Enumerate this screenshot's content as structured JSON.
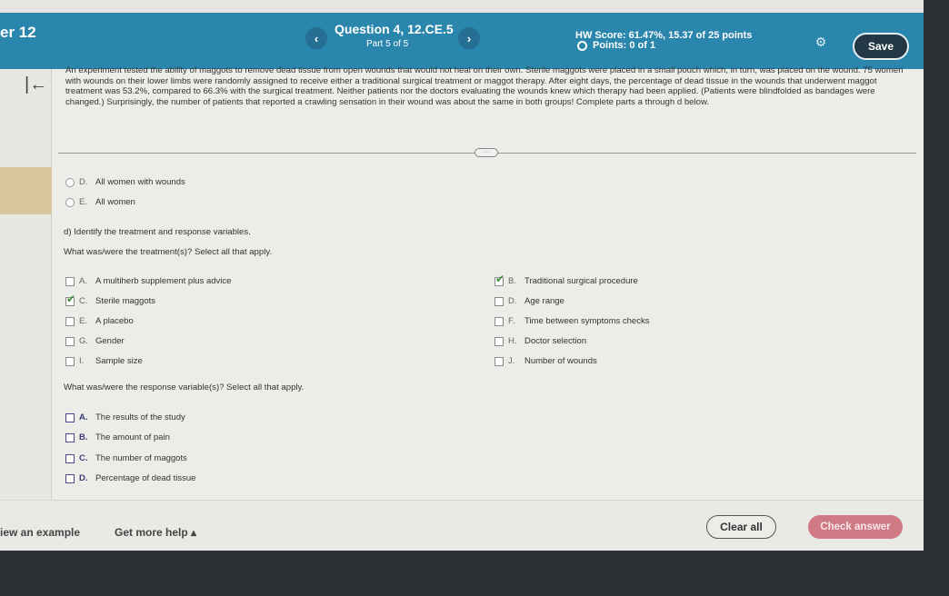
{
  "header": {
    "chapter": "er 12",
    "question_title": "Question 4, 12.CE.5",
    "question_part": "Part 5 of 5",
    "prev_icon": "chevron-left-icon",
    "prev_glyph": "‹",
    "next_icon": "chevron-right-icon",
    "next_glyph": "›",
    "hw_score": "HW Score: 61.47%, 15.37 of 25 points",
    "points": "Points: 0 of 1",
    "gear_glyph": "⚙",
    "save_label": "Save"
  },
  "sidebar": {
    "collapse_glyph": "|←"
  },
  "intro_text": "An experiment tested the ability of maggots to remove dead tissue from open wounds that would not heal on their own. Sterile maggots were placed in a small pouch which, in turn, was placed on the wound. 75 women with wounds on their lower limbs were randomly assigned to receive either a traditional surgical treatment or maggot therapy. After eight days, the percentage of dead tissue in the wounds that underwent maggot treatment was 53.2%, compared to 66.3% with the surgical treatment. Neither patients nor the doctors evaluating the wounds knew which therapy had been applied. (Patients were blindfolded as bandages were changed.) Surprisingly, the number of patients that reported a crawling sensation in their wound was about the same in both groups! Complete parts a through d below.",
  "divider_handle": "···",
  "prev_part_options": [
    {
      "letter": "D.",
      "label": "All women with wounds"
    },
    {
      "letter": "E.",
      "label": "All women"
    }
  ],
  "part_d": {
    "prompt": "d) Identify the treatment and response variables.",
    "treatment_question": "What was/were the treatment(s)? Select all that apply.",
    "treatment_options_left": [
      {
        "letter": "A.",
        "label": "A multiherb supplement plus advice",
        "checked": false
      },
      {
        "letter": "C.",
        "label": "Sterile maggots",
        "checked": true
      },
      {
        "letter": "E.",
        "label": "A placebo",
        "checked": false
      },
      {
        "letter": "G.",
        "label": "Gender",
        "checked": false
      },
      {
        "letter": "I.",
        "label": "Sample size",
        "checked": false
      }
    ],
    "treatment_options_right": [
      {
        "letter": "B.",
        "label": "Traditional surgical procedure",
        "checked": true
      },
      {
        "letter": "D.",
        "label": "Age range",
        "checked": false
      },
      {
        "letter": "F.",
        "label": "Time between symptoms checks",
        "checked": false
      },
      {
        "letter": "H.",
        "label": "Doctor selection",
        "checked": false
      },
      {
        "letter": "J.",
        "label": "Number of wounds",
        "checked": false
      }
    ],
    "response_question": "What was/were the response variable(s)? Select all that apply.",
    "response_options": [
      {
        "letter": "A.",
        "label": "The results of the study",
        "checked": false
      },
      {
        "letter": "B.",
        "label": "The amount of pain",
        "checked": false
      },
      {
        "letter": "C.",
        "label": "The number of maggots",
        "checked": false
      },
      {
        "letter": "D.",
        "label": "Percentage of dead tissue",
        "checked": false
      }
    ]
  },
  "footer": {
    "view_example": "iew an example",
    "get_help": "Get more help ▴",
    "clear_all": "Clear all",
    "check_answer": "Check answer"
  },
  "colors": {
    "header_bg": "#2a86ad",
    "save_bg": "#233845",
    "check_answer_bg": "#d07a85",
    "checkmark": "#3b8a3b"
  }
}
